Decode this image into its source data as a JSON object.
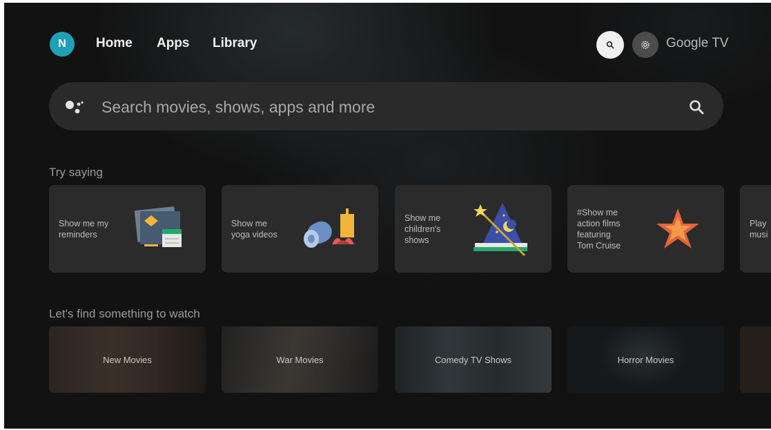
{
  "avatar": {
    "initial": "N",
    "color": "#1fa0b7"
  },
  "nav": {
    "tabs": [
      {
        "label": "Home"
      },
      {
        "label": "Apps"
      },
      {
        "label": "Library"
      }
    ]
  },
  "top_actions": {
    "search_icon": "search-icon",
    "settings_icon": "gear-icon",
    "brand": "Google TV"
  },
  "search": {
    "placeholder": "Search movies, shows, apps and more",
    "assistant_icon": "google-assistant-icon",
    "icon": "search-icon"
  },
  "try_saying": {
    "title": "Try saying",
    "cards": [
      {
        "text": "Show me my\nreminders",
        "icon": "reminders-illustration"
      },
      {
        "text": "Show me\nyoga videos",
        "icon": "yoga-illustration"
      },
      {
        "text": "Show me\nchildren's\nshows",
        "icon": "wizard-hat-illustration"
      },
      {
        "text": "#Show me\naction films\nfeaturing\nTom Cruise",
        "icon": "star-illustration"
      },
      {
        "text": "Play\nmusi"
      }
    ]
  },
  "find_watch": {
    "title": "Let's find something to watch",
    "tiles": [
      {
        "label": "New Movies"
      },
      {
        "label": "War Movies"
      },
      {
        "label": "Comedy TV Shows"
      },
      {
        "label": "Horror Movies"
      },
      {
        "label": ""
      }
    ]
  },
  "colors": {
    "background": "#121212",
    "card": "#2b2b2b",
    "search_bar": "#2a2a2a",
    "text_primary": "#f1f1f1",
    "text_muted": "#9a9a9a"
  }
}
